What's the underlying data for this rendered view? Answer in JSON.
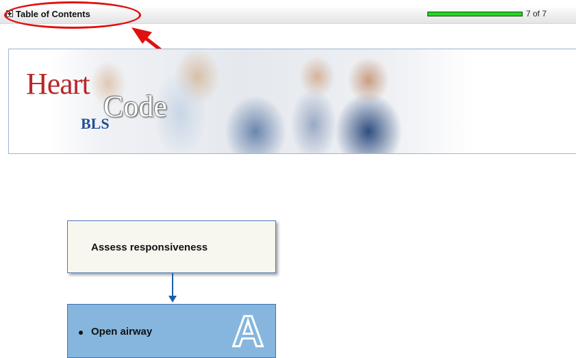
{
  "toc": {
    "label": "Table of Contents",
    "expand_icon": "plus-box-icon"
  },
  "progress": {
    "current": 7,
    "total": 7,
    "fraction": 1.0,
    "text": "7 of 7",
    "fill_color": "#22d622"
  },
  "annotation": {
    "ellipse_color": "#e01010",
    "arrow_color": "#e01010"
  },
  "banner": {
    "logo_heart": "Heart",
    "logo_code": "Code",
    "logo_bls": "BLS",
    "heart_color": "#b8282a",
    "bls_color": "#1f4f99"
  },
  "flowchart": {
    "step1_label": "Assess responsiveness",
    "step2_label": "Open airway",
    "step2_letter": "A",
    "step2_color": "#86b6dd",
    "connector_color": "#1b5fa8"
  }
}
